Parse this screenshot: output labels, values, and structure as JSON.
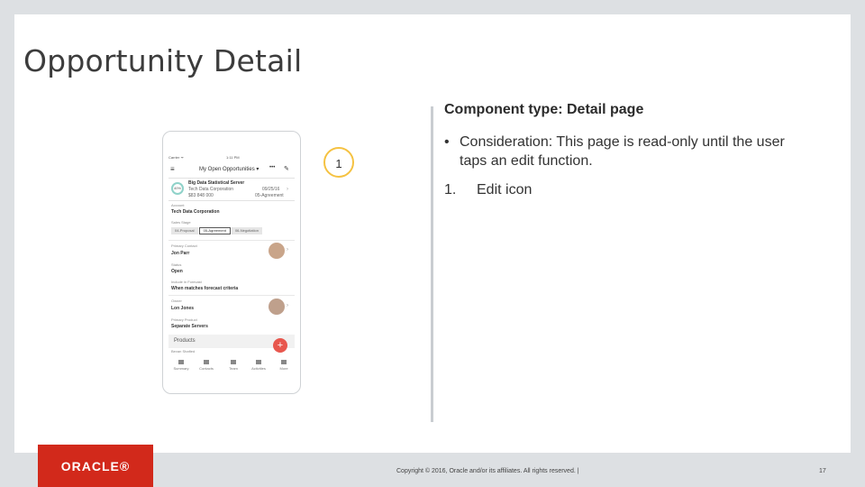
{
  "slide": {
    "title": "Opportunity Detail",
    "component_type": "Component type: Detail page",
    "bullet": "Consideration: This page is read-only until the user taps an edit function.",
    "bullet_symbol": "•",
    "list_number": "1.",
    "list_item": "Edit icon",
    "callout_number": "1"
  },
  "phone": {
    "status_left": "Carrier ᯤ",
    "status_center": "1:11 PM",
    "nav_menu_icon": "≡",
    "nav_title": "My Open Opportunities",
    "nav_dropdown": "▾",
    "nav_more": "•••",
    "nav_edit_icon": "✎",
    "header": {
      "ring_text": "40%",
      "name": "Big Data Statistical Server",
      "company": "Tech Data Corporation",
      "amount": "$83 848 000",
      "date": "09/25/16",
      "stage": "05-Agreement",
      "chevron": "›"
    },
    "fields": {
      "account_label": "Account",
      "account_value": "Tech Data Corporation",
      "sales_stage_label": "Sales Stage",
      "stages": [
        "04-Proposal",
        "05-Agreement",
        "06-Negotiation"
      ],
      "primary_contact_label": "Primary Contact",
      "primary_contact_value": "Jon Parr",
      "status_label": "Status",
      "status_value": "Open",
      "forecast_label": "Include in Forecast",
      "forecast_value": "When matches forecast criteria",
      "owner_label": "Owner",
      "owner_value": "Lon Jones",
      "product_label": "Primary Product",
      "product_value": "Separate Servers",
      "products_section": "Products",
      "products_sub": "Bevan Shafted",
      "fab_icon": "+"
    },
    "tabs": [
      "Summary",
      "Contacts",
      "Team",
      "Activities",
      "More"
    ]
  },
  "footer": {
    "logo": "ORACLE®",
    "copyright": "Copyright © 2016, Oracle and/or its affiliates. All rights reserved. |",
    "page_number": "17"
  },
  "colors": {
    "accent": "#d2291b",
    "callout_border": "#f5c242",
    "fab": "#e8574e"
  }
}
